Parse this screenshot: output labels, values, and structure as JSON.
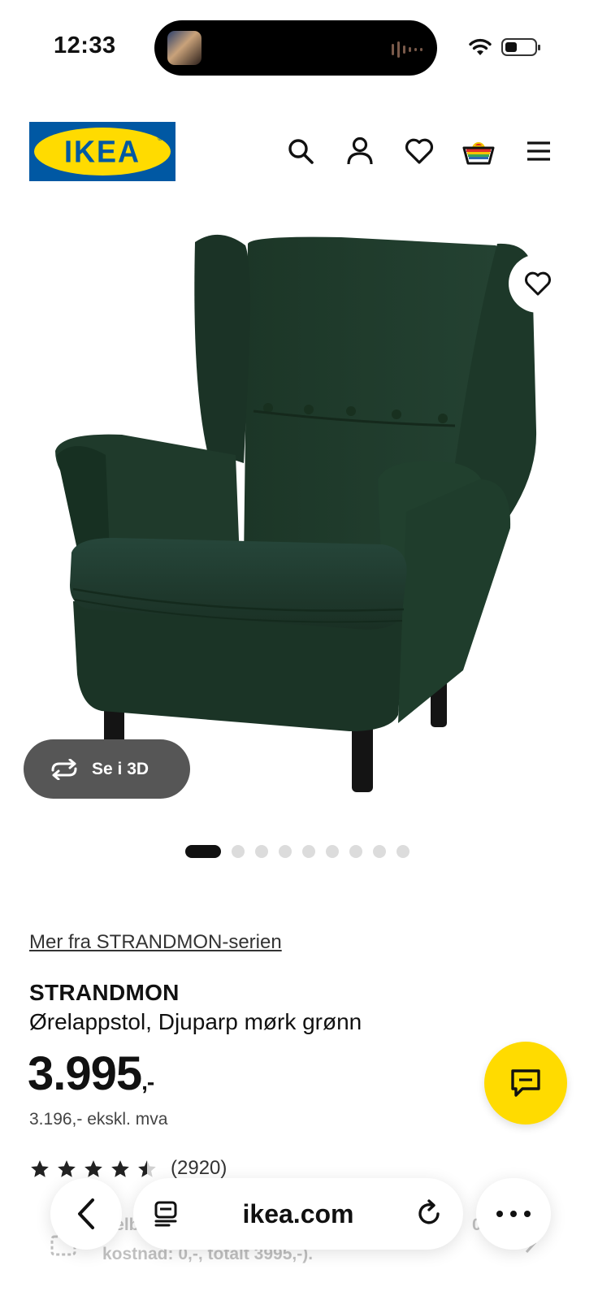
{
  "status_bar": {
    "time": "12:33",
    "icons": [
      "now-playing-art-icon",
      "audio-waveform-icon",
      "wifi-icon",
      "battery-icon"
    ]
  },
  "header": {
    "logo_text": "IKEA",
    "logo_registered": "®",
    "icons": [
      "search-icon",
      "account-icon",
      "wishlist-heart-icon",
      "shopping-basket-icon",
      "menu-icon"
    ]
  },
  "gallery": {
    "see_3d_label": "Se i 3D",
    "image_count": 9,
    "active_index": 0
  },
  "product": {
    "series_link": "Mer fra STRANDMON-serien",
    "name": "STRANDMON",
    "description": "Ørelappstol, Djuparp mørk grønn",
    "price": "3.995",
    "price_suffix": ",-",
    "price_excl_vat": "3.196,- ekskl. mva",
    "rating_value": 4.5,
    "rating_max": 5,
    "rating_count": "(2920)"
  },
  "financing": {
    "text_line1": "Delbe",
    "text_line1_end": "0.0%,",
    "text_line2": "kostnad: 0,-, totalt 3995,-)."
  },
  "browser": {
    "url": "ikea.com"
  },
  "colors": {
    "ikea_blue": "#0058a3",
    "ikea_yellow": "#ffdb00",
    "chair_green": "#1e3a2a",
    "see3d_bg": "#565656"
  }
}
